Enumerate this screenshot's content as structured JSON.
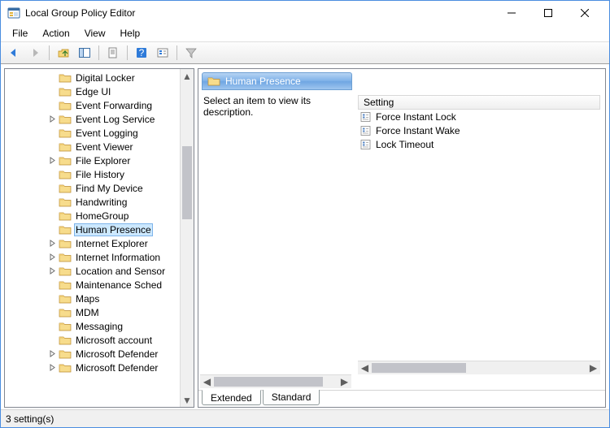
{
  "window": {
    "title": "Local Group Policy Editor"
  },
  "menu": {
    "file": "File",
    "action": "Action",
    "view": "View",
    "help": "Help"
  },
  "tree": {
    "items": [
      {
        "label": "Digital Locker",
        "expandable": false
      },
      {
        "label": "Edge UI",
        "expandable": false
      },
      {
        "label": "Event Forwarding",
        "expandable": false
      },
      {
        "label": "Event Log Service",
        "expandable": true
      },
      {
        "label": "Event Logging",
        "expandable": false
      },
      {
        "label": "Event Viewer",
        "expandable": false
      },
      {
        "label": "File Explorer",
        "expandable": true
      },
      {
        "label": "File History",
        "expandable": false
      },
      {
        "label": "Find My Device",
        "expandable": false
      },
      {
        "label": "Handwriting",
        "expandable": false
      },
      {
        "label": "HomeGroup",
        "expandable": false
      },
      {
        "label": "Human Presence",
        "expandable": false,
        "selected": true
      },
      {
        "label": "Internet Explorer",
        "expandable": true
      },
      {
        "label": "Internet Information",
        "expandable": true
      },
      {
        "label": "Location and Sensor",
        "expandable": true
      },
      {
        "label": "Maintenance Sched",
        "expandable": false
      },
      {
        "label": "Maps",
        "expandable": false
      },
      {
        "label": "MDM",
        "expandable": false
      },
      {
        "label": "Messaging",
        "expandable": false
      },
      {
        "label": "Microsoft account",
        "expandable": false
      },
      {
        "label": "Microsoft Defender",
        "expandable": true
      },
      {
        "label": "Microsoft Defender",
        "expandable": true
      }
    ]
  },
  "detail": {
    "header": "Human Presence",
    "description": "Select an item to view its description.",
    "column_header": "Setting",
    "settings": [
      "Force Instant Lock",
      "Force Instant Wake",
      "Lock Timeout"
    ]
  },
  "tabs": {
    "extended": "Extended",
    "standard": "Standard"
  },
  "status": {
    "text": "3 setting(s)"
  }
}
